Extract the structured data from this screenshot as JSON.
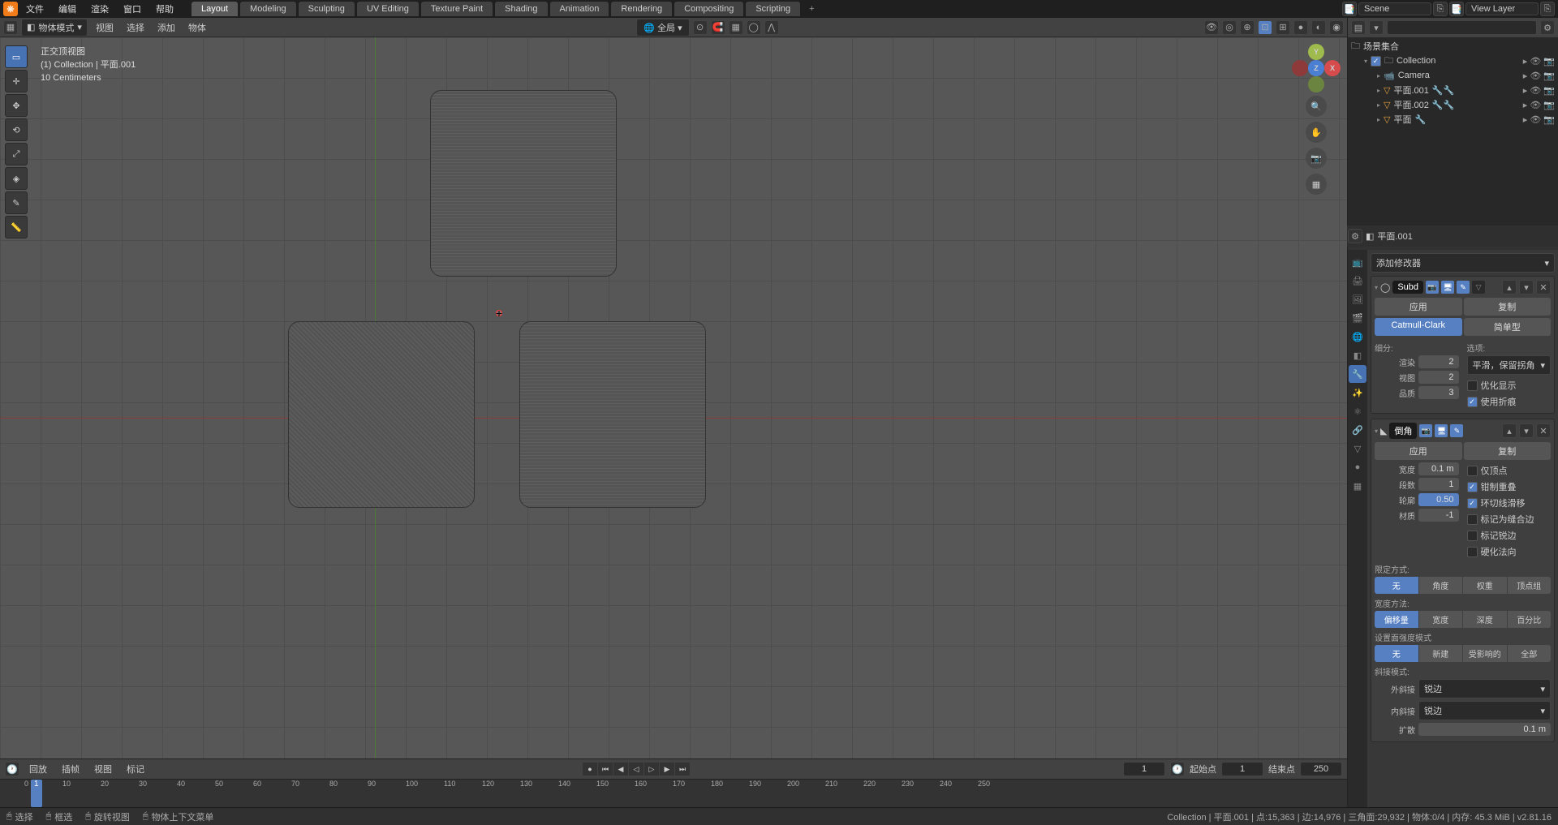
{
  "topmenu": {
    "file": "文件",
    "edit": "编辑",
    "render": "渲染",
    "window": "窗口",
    "help": "帮助"
  },
  "workspaces": [
    "Layout",
    "Modeling",
    "Sculpting",
    "UV Editing",
    "Texture Paint",
    "Shading",
    "Animation",
    "Rendering",
    "Compositing",
    "Scripting"
  ],
  "active_workspace": "Layout",
  "scene_field": "Scene",
  "viewlayer_field": "View Layer",
  "viewport": {
    "mode": "物体模式",
    "menus": {
      "view": "视图",
      "select": "选择",
      "add": "添加",
      "object": "物体"
    },
    "orient": "全局",
    "overlay": {
      "title": "正交顶视图",
      "subtitle": "(1) Collection | 平面.001",
      "scale": "10 Centimeters"
    }
  },
  "outliner": {
    "root": "场景集合",
    "collection": "Collection",
    "items": [
      {
        "name": "Camera",
        "type": "camera"
      },
      {
        "name": "平面.001",
        "type": "mesh"
      },
      {
        "name": "平面.002",
        "type": "mesh"
      },
      {
        "name": "平面",
        "type": "mesh"
      }
    ]
  },
  "props": {
    "object_name": "平面.001",
    "add_modifier": "添加修改器",
    "subd": {
      "name": "Subd",
      "apply": "应用",
      "copy": "复制",
      "type1": "Catmull-Clark",
      "type2": "简单型",
      "subdiv_label": "细分:",
      "opts_label": "选项:",
      "render_label": "渲染",
      "render_val": "2",
      "view_label": "视图",
      "view_val": "2",
      "quality_label": "品质",
      "quality_val": "3",
      "uv_smooth": "平滑，保留拐角",
      "opt1": "优化显示",
      "opt2": "使用折痕"
    },
    "bevel": {
      "name": "倒角",
      "apply": "应用",
      "copy": "复制",
      "width_label": "宽度",
      "width_val": "0.1 m",
      "seg_label": "段数",
      "seg_val": "1",
      "profile_label": "轮廓",
      "profile_val": "0.50",
      "mat_label": "材质",
      "mat_val": "-1",
      "c1": "仅顶点",
      "c2": "钳制重叠",
      "c3": "环切线滑移",
      "c4": "标记为缝合边",
      "c5": "标记锐边",
      "c6": "硬化法向",
      "limit_label": "限定方式:",
      "limit": [
        "无",
        "角度",
        "权重",
        "顶点组"
      ],
      "width_method_label": "宽度方法:",
      "width_method": [
        "偏移量",
        "宽度",
        "深度",
        "百分比"
      ],
      "face_strength_label": "设置面强度模式",
      "face_strength": [
        "无",
        "新建",
        "受影响的",
        "全部"
      ],
      "miter_label": "斜接模式:",
      "outer_label": "外斜接",
      "outer_val": "锐边",
      "inner_label": "内斜接",
      "inner_val": "锐边",
      "spread_label": "扩散",
      "spread_val": "0.1 m"
    }
  },
  "timeline": {
    "playback": "回放",
    "keying": "插帧",
    "view": "视图",
    "marker": "标记",
    "ticks": [
      0,
      10,
      20,
      30,
      40,
      50,
      60,
      70,
      80,
      90,
      100,
      110,
      120,
      130,
      140,
      150,
      160,
      170,
      180,
      190,
      200,
      210,
      220,
      230,
      240,
      250
    ],
    "current": "1",
    "start_label": "起始点",
    "start": "1",
    "end_label": "结束点",
    "end": "250",
    "frame": "1"
  },
  "status": {
    "s1": "选择",
    "s2": "框选",
    "s3": "旋转视图",
    "s4": "物体上下文菜单",
    "right": "Collection | 平面.001 | 点:15,363 | 边:14,976 | 三角面:29,932 | 物体:0/4 | 内存: 45.3 MiB | v2.81.16"
  }
}
